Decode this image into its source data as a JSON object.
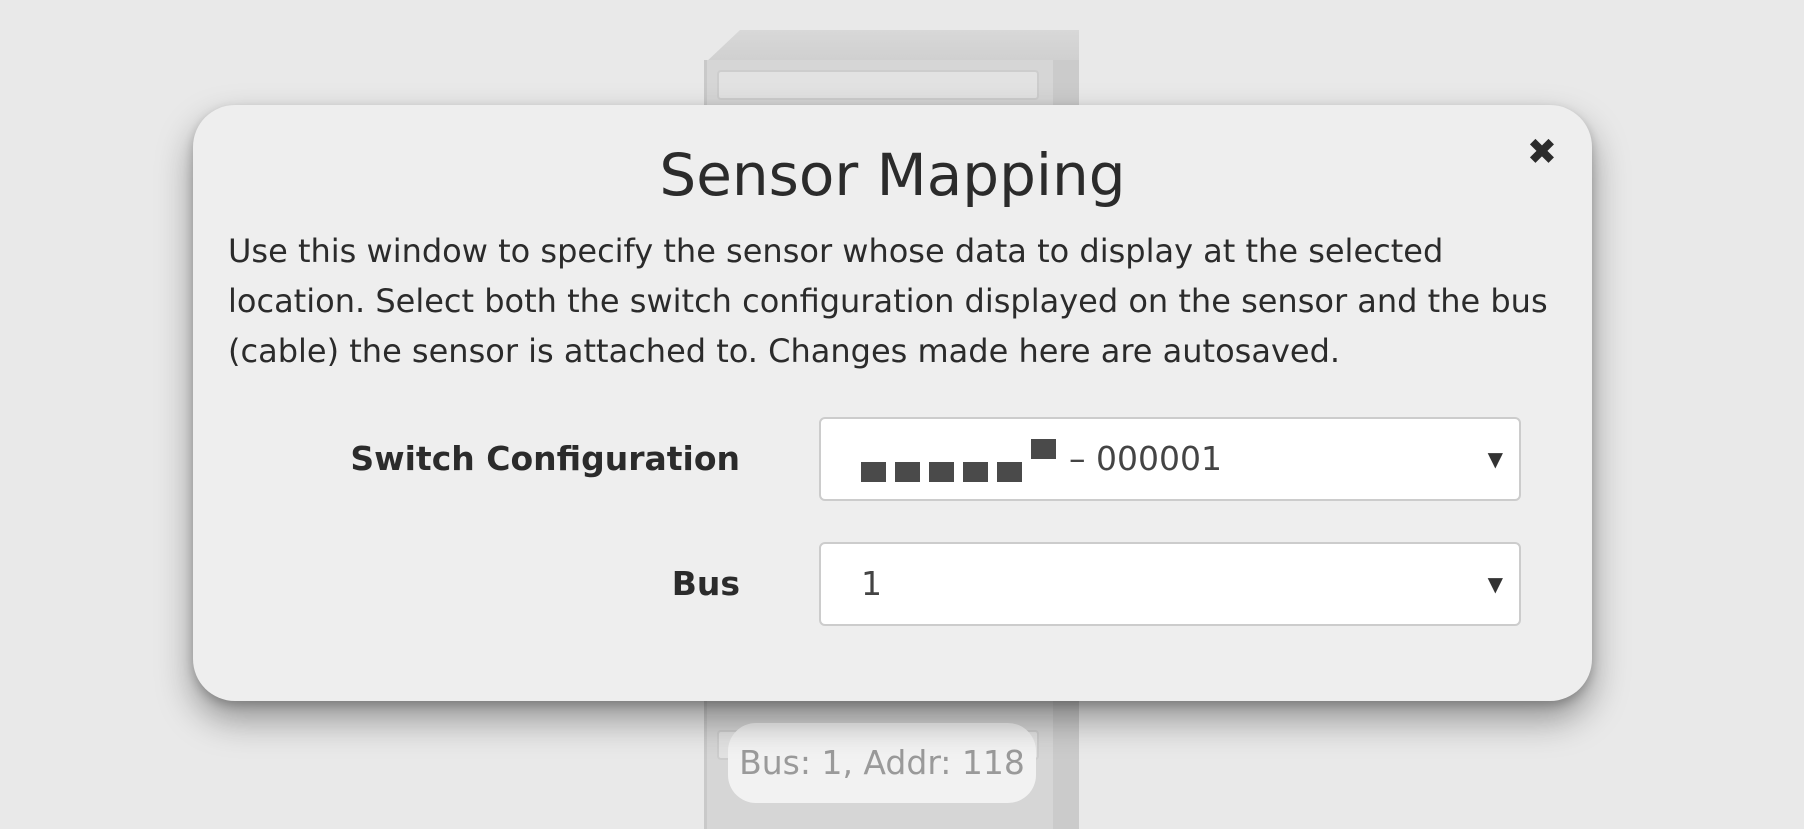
{
  "background": {
    "bus_tag": "Bus: 1, Addr: 118"
  },
  "modal": {
    "title": "Sensor Mapping",
    "close_icon": "close-icon",
    "description": "Use this window to specify the sensor whose data to display at the selected location. Select both the switch configuration displayed on the sensor and the bus (cable) the sensor is attached to. Changes made here are autosaved.",
    "switch_configuration": {
      "label": "Switch Configuration",
      "value": "– 000001",
      "switch_positions": [
        "down",
        "down",
        "down",
        "down",
        "down",
        "up"
      ]
    },
    "bus": {
      "label": "Bus",
      "value": "1"
    }
  },
  "colors": {
    "page_background": "#e9e9e9",
    "modal_background": "#eeeeee",
    "text": "#2b2b2b",
    "select_border": "#cccccc"
  }
}
